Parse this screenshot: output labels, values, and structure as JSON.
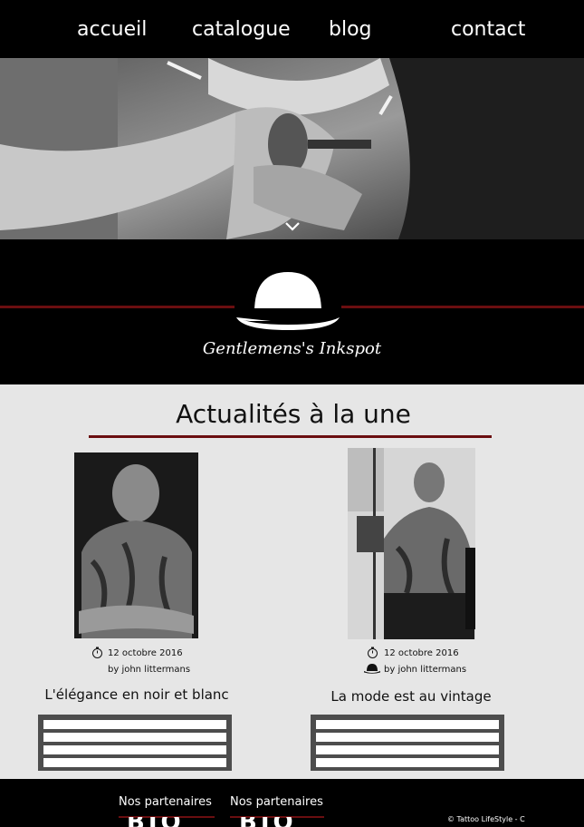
{
  "nav": {
    "items": [
      {
        "label": "accueil"
      },
      {
        "label": "catalogue"
      },
      {
        "label": "blog"
      },
      {
        "label": "contact"
      }
    ]
  },
  "brand": {
    "name": "Gentlemens's Inkspot"
  },
  "main": {
    "title": "Actualités à la une",
    "articles": [
      {
        "date": "12 octobre 2016",
        "author": "by john littermans",
        "title": "L'élégance en noir et blanc"
      },
      {
        "date": "12 octobre 2016",
        "author": "by john littermans",
        "title": "La mode est au vintage"
      }
    ]
  },
  "footer": {
    "partners": [
      {
        "label": "Nos partenaires",
        "logo": "BIO"
      },
      {
        "label": "Nos partenaires",
        "logo": "BIO"
      }
    ],
    "copyright": "© Tattoo LifeStyle - C"
  },
  "icons": {
    "chevron": "chevron-down-icon",
    "bowler": "bowler-hat-icon",
    "clock": "stopwatch-icon"
  },
  "colors": {
    "accent": "#6b0e10",
    "bar": "#000000",
    "panel": "#e6e6e6"
  }
}
